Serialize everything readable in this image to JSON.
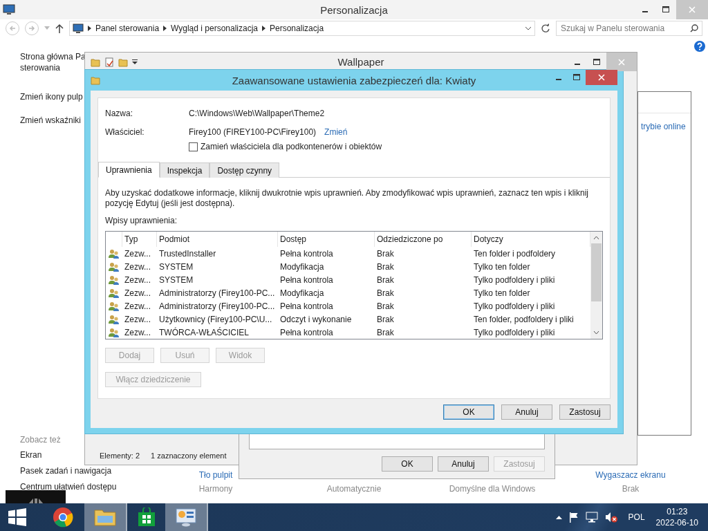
{
  "control_panel": {
    "title": "Personalizacja",
    "breadcrumb": [
      "Panel sterowania",
      "Wygląd i personalizacja",
      "Personalizacja"
    ],
    "search": {
      "placeholder": "Szukaj w Panelu sterowania"
    },
    "sidebar_links": [
      {
        "lines": [
          "Strona główna Pa",
          "sterowania"
        ]
      },
      {
        "lines": [
          "Zmień ikony pulp"
        ]
      },
      {
        "lines": [
          "Zmień wskaźniki"
        ]
      }
    ],
    "online_link": "trybie online",
    "see_also": {
      "heading": "Zobacz też",
      "links": [
        "Ekran",
        "Pasek zadań i nawigacja",
        "Centrum ułatwień dostępu"
      ]
    },
    "bottom_items": [
      {
        "link": "Tło pulpit",
        "value": "Harmony"
      },
      {
        "value": "Automatycznie"
      },
      {
        "value": "Domyślne dla Windows"
      },
      {
        "link": "Wygaszacz ekranu",
        "value": "Brak"
      }
    ]
  },
  "wallpaper_window": {
    "title": "Wallpaper",
    "status": [
      "Elementy: 2",
      "1 zaznaczony element"
    ]
  },
  "properties_dialog": {
    "buttons": [
      {
        "label": "OK",
        "disabled": false
      },
      {
        "label": "Anuluj",
        "disabled": false
      },
      {
        "label": "Zastosuj",
        "disabled": true
      }
    ]
  },
  "security_dialog": {
    "title": "Zaawansowane ustawienia zabezpieczeń dla: Kwiaty",
    "name_label": "Nazwa:",
    "name": "C:\\Windows\\Web\\Wallpaper\\Theme2",
    "owner_label": "Właściciel:",
    "owner": "Firey100 (FIREY100-PC\\Firey100)",
    "change_link": "Zmień",
    "replace_owner": {
      "label": "Zamień właściciela dla podkontenerów i obiektów",
      "checked": false
    },
    "tabs": [
      {
        "label": "Uprawnienia",
        "selected": true
      },
      {
        "label": "Inspekcja",
        "selected": false
      },
      {
        "label": "Dostęp czynny",
        "selected": false
      }
    ],
    "info": "Aby uzyskać dodatkowe informacje, kliknij dwukrotnie wpis uprawnień. Aby zmodyfikować wpis uprawnień, zaznacz ten wpis i kliknij pozycję Edytuj (jeśli jest dostępna).",
    "entries_label": "Wpisy uprawnienia:",
    "table": {
      "columns": [
        "Typ",
        "Podmiot",
        "Dostęp",
        "Odziedziczone po",
        "Dotyczy"
      ],
      "rows": [
        [
          "Zezw...",
          "TrustedInstaller",
          "Pełna kontrola",
          "Brak",
          "Ten folder i podfoldery"
        ],
        [
          "Zezw...",
          "SYSTEM",
          "Modyfikacja",
          "Brak",
          "Tylko ten folder"
        ],
        [
          "Zezw...",
          "SYSTEM",
          "Pełna kontrola",
          "Brak",
          "Tylko podfoldery i pliki"
        ],
        [
          "Zezw...",
          "Administratorzy (Firey100-PC...",
          "Modyfikacja",
          "Brak",
          "Tylko ten folder"
        ],
        [
          "Zezw...",
          "Administratorzy (Firey100-PC...",
          "Pełna kontrola",
          "Brak",
          "Tylko podfoldery i pliki"
        ],
        [
          "Zezw...",
          "Użytkownicy (Firey100-PC\\U...",
          "Odczyt i wykonanie",
          "Brak",
          "Ten folder, podfoldery i pliki"
        ],
        [
          "Zezw...",
          "TWÓRCA-WŁAŚCICIEL",
          "Pełna kontrola",
          "Brak",
          "Tylko podfoldery i pliki"
        ]
      ]
    },
    "actions": [
      {
        "label": "Dodaj",
        "disabled": true
      },
      {
        "label": "Usuń",
        "disabled": true
      },
      {
        "label": "Widok",
        "disabled": true
      }
    ],
    "inherit_button": {
      "label": "Włącz dziedziczenie",
      "disabled": true
    },
    "buttons": [
      {
        "label": "OK",
        "default": true
      },
      {
        "label": "Anuluj",
        "default": false
      },
      {
        "label": "Zastosuj",
        "default": false
      }
    ]
  },
  "taskbar": {
    "apps": [
      {
        "kind": "chrome",
        "active": false
      },
      {
        "kind": "explorer",
        "active": true
      },
      {
        "kind": "store",
        "active": false
      },
      {
        "kind": "control",
        "active": true
      }
    ],
    "language": "POL",
    "time": "01:23",
    "date": "2022-06-10"
  }
}
